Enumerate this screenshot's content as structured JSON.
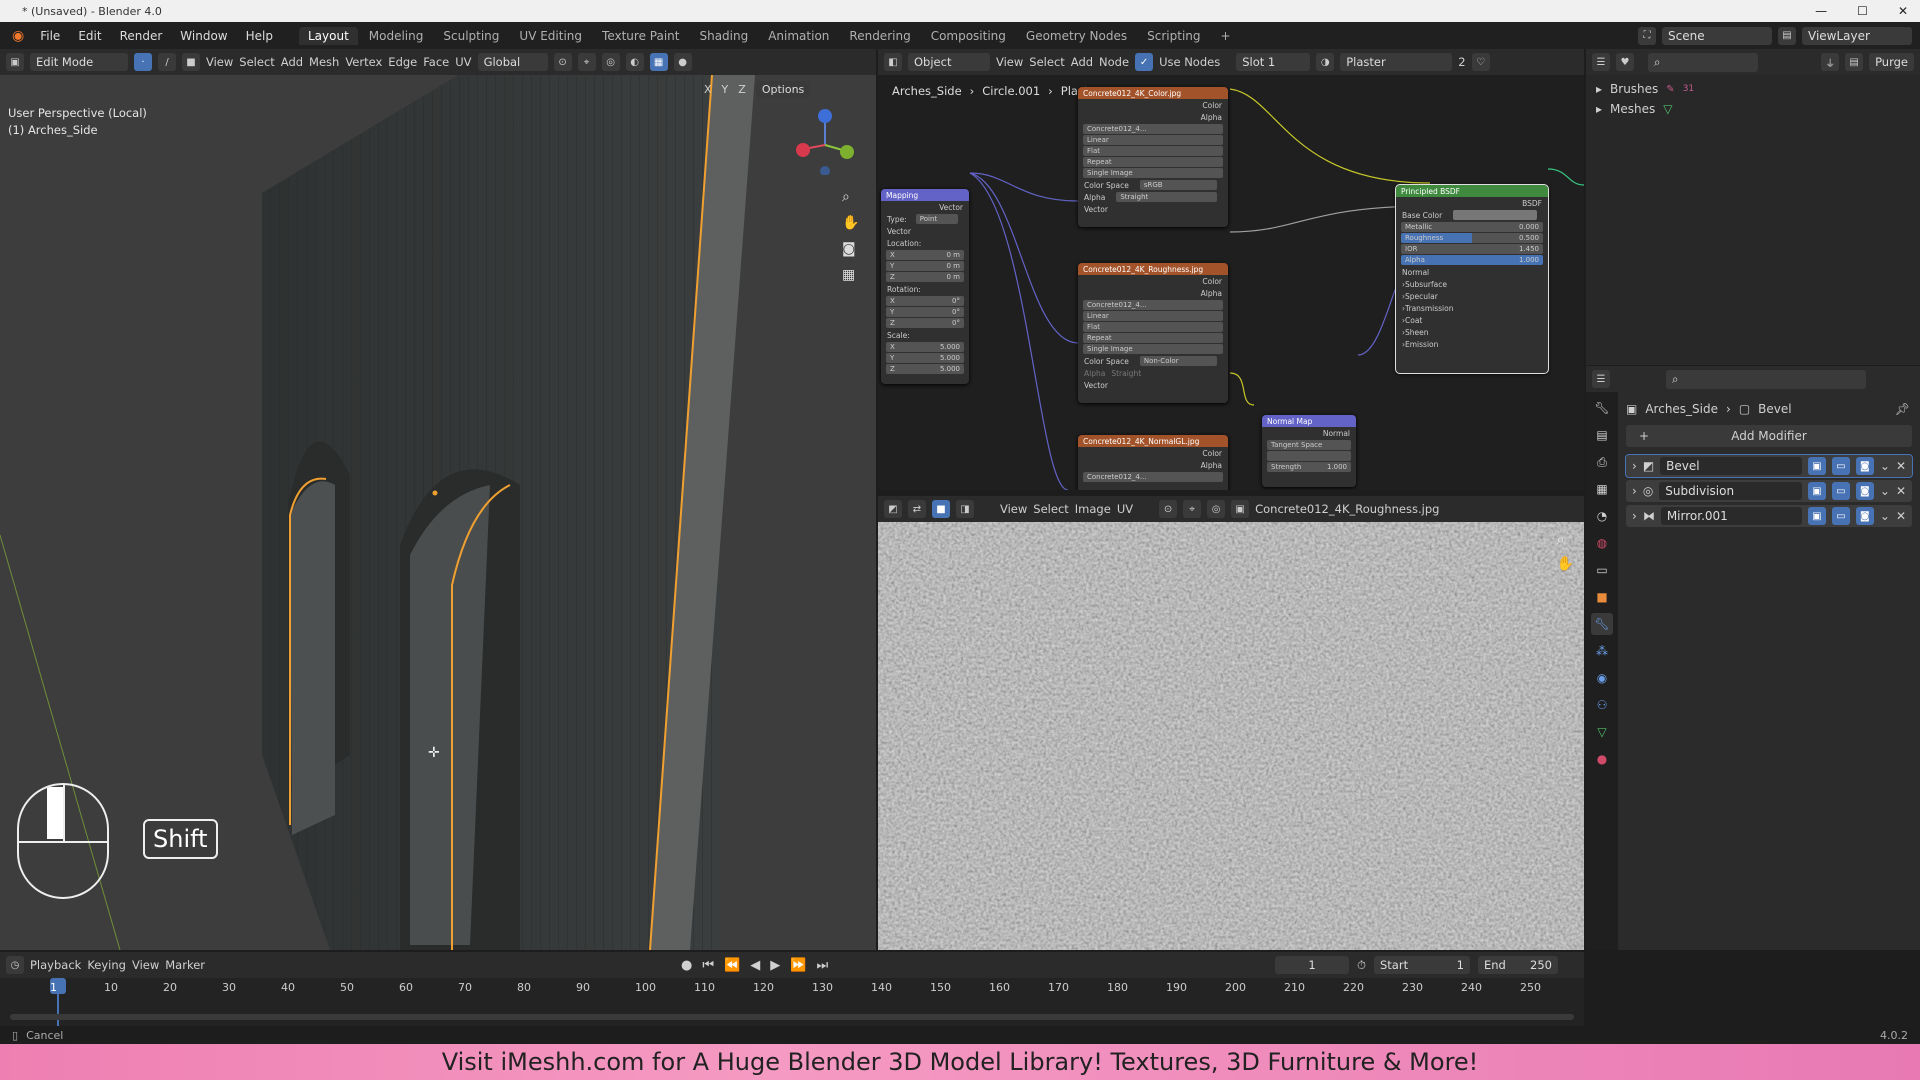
{
  "titlebar": {
    "title": "* (Unsaved) - Blender 4.0"
  },
  "menubar": {
    "items": [
      "File",
      "Edit",
      "Render",
      "Window",
      "Help"
    ]
  },
  "workspaces": [
    "Layout",
    "Modeling",
    "Sculpting",
    "UV Editing",
    "Texture Paint",
    "Shading",
    "Animation",
    "Rendering",
    "Compositing",
    "Geometry Nodes",
    "Scripting"
  ],
  "scene": {
    "label": "Scene",
    "viewlayer": "ViewLayer"
  },
  "viewport": {
    "mode": "Edit Mode",
    "menus": [
      "View",
      "Select",
      "Add",
      "Mesh",
      "Vertex",
      "Edge",
      "Face",
      "UV"
    ],
    "transform": "Global",
    "info_line1": "User Perspective (Local)",
    "info_line2": "(1) Arches_Side",
    "axes": [
      "X",
      "Y",
      "Z"
    ],
    "options_label": "Options",
    "key_hint": "Shift"
  },
  "nodeeditor": {
    "object_label": "Object",
    "menus": [
      "View",
      "Select",
      "Add",
      "Node"
    ],
    "use_nodes": "Use Nodes",
    "slot": "Slot 1",
    "material": "Plaster",
    "users": "2",
    "breadcrumb": [
      "Arches_Side",
      "Circle.001",
      "Plaster"
    ],
    "mapping": {
      "title": "Mapping",
      "out": "Vector",
      "type_label": "Type:",
      "type": "Point",
      "vector": "Vector",
      "location": "Location:",
      "loc": [
        "0 m",
        "0 m",
        "0 m"
      ],
      "rotation": "Rotation:",
      "rot": [
        "0°",
        "0°",
        "0°"
      ],
      "scale": "Scale:",
      "scl": [
        "5.000",
        "5.000",
        "5.000"
      ],
      "xyz": [
        "X",
        "Y",
        "Z"
      ]
    },
    "tex1": {
      "title": "Concrete012_4K_Color.jpg",
      "color": "Color",
      "alpha": "Alpha",
      "img": "Concrete012_4...",
      "interp": "Linear",
      "proj": "Flat",
      "ext": "Repeat",
      "src": "Single Image",
      "cs_label": "Color Space",
      "cs": "sRGB",
      "alpha_label": "Alpha",
      "alpha_mode": "Straight",
      "vector": "Vector"
    },
    "tex2": {
      "title": "Concrete012_4K_Roughness.jpg",
      "color": "Color",
      "alpha": "Alpha",
      "img": "Concrete012_4...",
      "interp": "Linear",
      "proj": "Flat",
      "ext": "Repeat",
      "src": "Single Image",
      "cs_label": "Color Space",
      "cs": "Non-Color",
      "alpha_label": "Alpha",
      "alpha_mode": "Straight",
      "vector": "Vector"
    },
    "tex3": {
      "title": "Concrete012_4K_NormalGL.jpg",
      "color": "Color",
      "alpha": "Alpha",
      "img": "Concrete012_4..."
    },
    "normalmap": {
      "title": "Normal Map",
      "out": "Normal",
      "space": "Tangent Space",
      "strength_label": "Strength",
      "strength": "1.000"
    },
    "bsdf": {
      "title": "Principled BSDF",
      "out": "BSDF",
      "base": "Base Color",
      "metallic_label": "Metallic",
      "metallic": "0.000",
      "rough_label": "Roughness",
      "rough": "0.500",
      "ior_label": "IOR",
      "ior": "1.450",
      "alpha_label": "Alpha",
      "alpha": "1.000",
      "normal": "Normal",
      "panels": [
        "Subsurface",
        "Specular",
        "Transmission",
        "Coat",
        "Sheen",
        "Emission"
      ]
    }
  },
  "imageeditor": {
    "menus": [
      "View",
      "Select",
      "Image",
      "UV"
    ],
    "image": "Concrete012_4K_Roughness.jpg"
  },
  "outliner": {
    "items": [
      "Brushes",
      "Meshes"
    ],
    "brush_count": "31",
    "purge": "Purge"
  },
  "properties": {
    "object": "Arches_Side",
    "modifier": "Bevel",
    "add_modifier": "Add Modifier",
    "modifiers": [
      "Bevel",
      "Subdivision",
      "Mirror.001"
    ]
  },
  "timeline": {
    "menus": [
      "Playback",
      "Keying",
      "View",
      "Marker"
    ],
    "current": "1",
    "start_label": "Start",
    "start": "1",
    "end_label": "End",
    "end": "250",
    "ticks": [
      "1",
      "10",
      "20",
      "30",
      "40",
      "50",
      "60",
      "70",
      "80",
      "90",
      "100",
      "110",
      "120",
      "130",
      "140",
      "150",
      "160",
      "170",
      "180",
      "190",
      "200",
      "210",
      "220",
      "230",
      "240",
      "250"
    ]
  },
  "status": {
    "left": "Cancel",
    "version": "4.0.2"
  },
  "banner": {
    "text": "Visit iMeshh.com for A Huge Blender 3D Model Library! Textures, 3D Furniture & More!"
  },
  "colors": {
    "accent": "#4772b3",
    "select": "#f0a030",
    "texnode": "#a2532a",
    "bsdf": "#3f8a3f",
    "vector": "#6363c7"
  }
}
